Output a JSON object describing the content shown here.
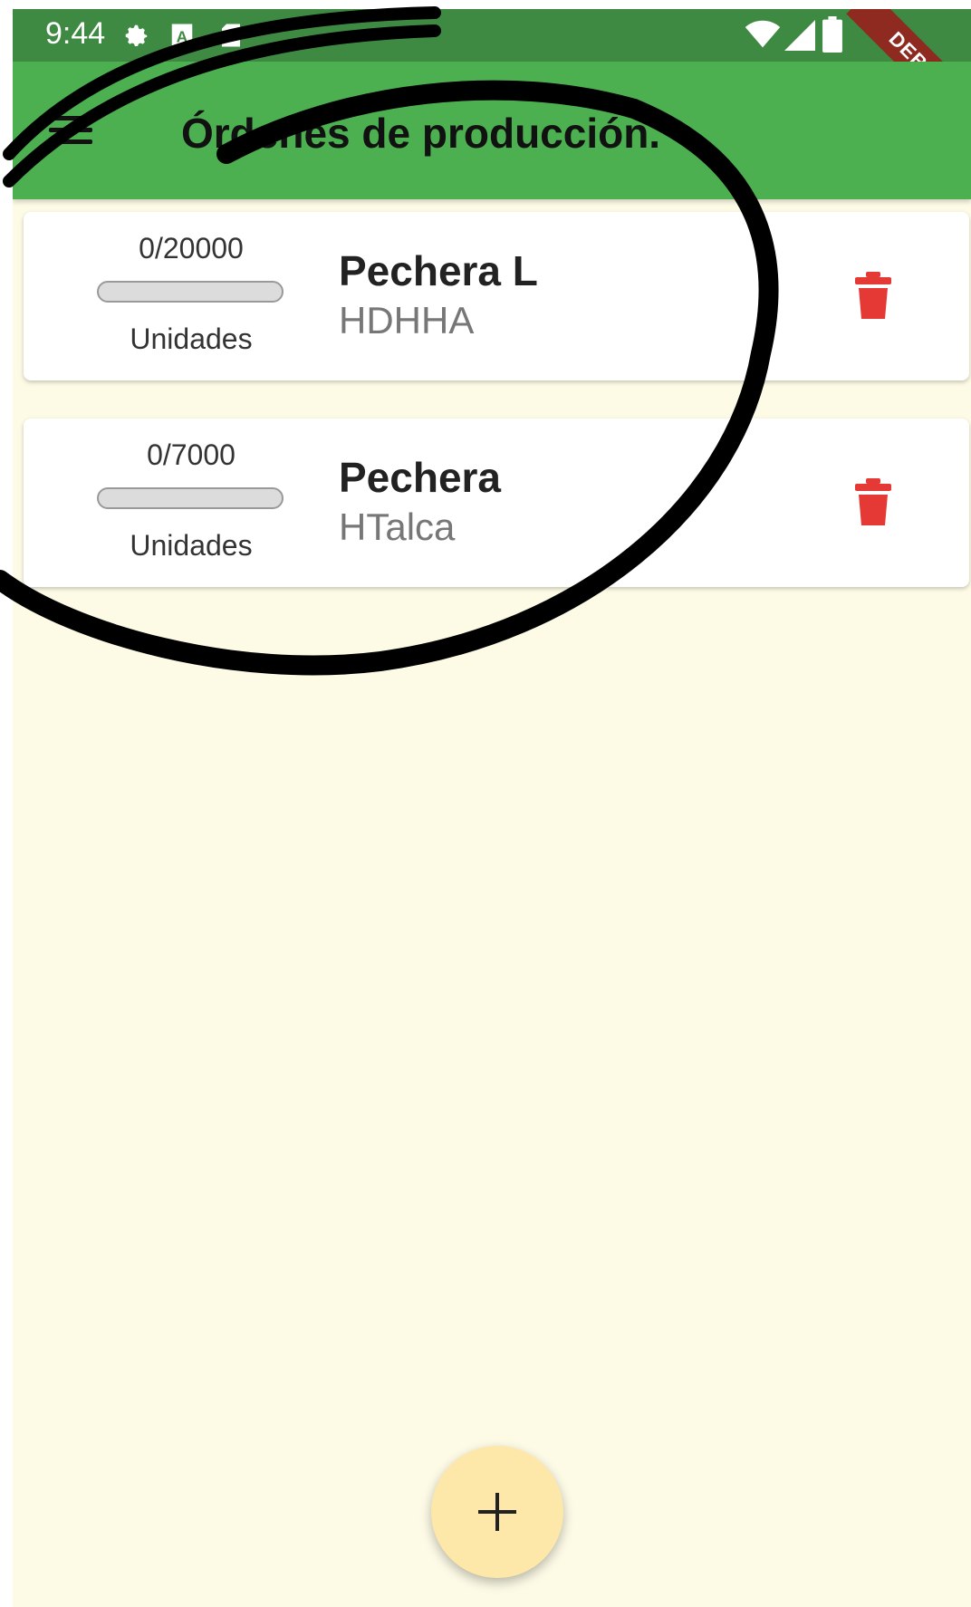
{
  "status_bar": {
    "time": "9:44",
    "icons": [
      "gear-icon",
      "font-a-icon",
      "sd-card-icon",
      "wifi-icon",
      "signal-icon",
      "battery-icon"
    ]
  },
  "app_bar": {
    "title": "Órdenes de producción.",
    "menu_icon": "menu-icon",
    "debug_label": "DEBUG"
  },
  "orders": [
    {
      "progress_text": "0/20000",
      "progress_fraction": 0,
      "unit_label": "Unidades",
      "name": "Pechera L",
      "client": "HDHHA",
      "delete_icon": "trash-icon"
    },
    {
      "progress_text": "0/7000",
      "progress_fraction": 0,
      "unit_label": "Unidades",
      "name": "Pechera",
      "client": "HTalca",
      "delete_icon": "trash-icon"
    }
  ],
  "fab": {
    "label": "+",
    "icon": "plus-icon"
  },
  "colors": {
    "status_bar": "#3f8a42",
    "app_bar": "#4caf50",
    "background": "#fdfbe6",
    "delete_icon": "#e53935",
    "fab": "#fde8a9",
    "debug_ribbon": "#8e2a1f",
    "annotation_stroke": "#000000"
  }
}
